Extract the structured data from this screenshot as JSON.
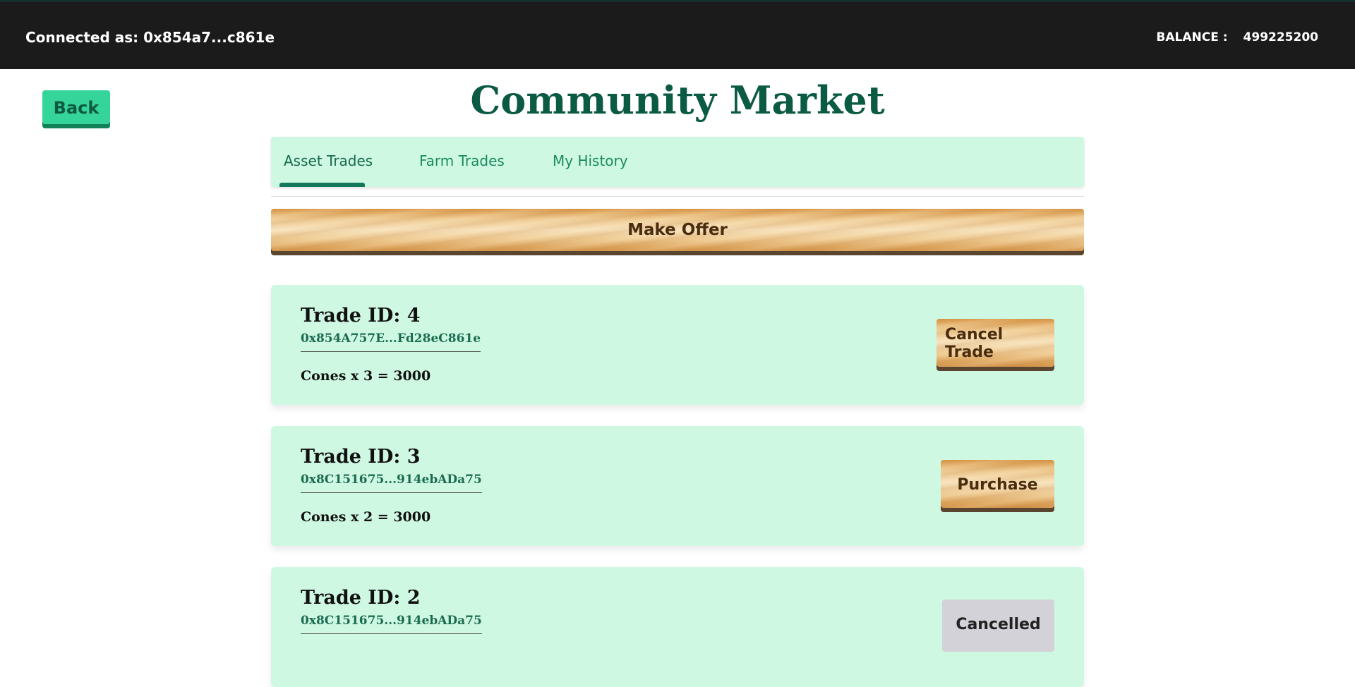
{
  "header": {
    "connected_text": "Connected as: 0x854a7...c861e",
    "balance_label": "BALANCE :",
    "balance_value": "499225200"
  },
  "back_label": "Back",
  "page_title": "Community Market",
  "tabs": [
    {
      "label": "Asset Trades",
      "active": true
    },
    {
      "label": "Farm Trades",
      "active": false
    },
    {
      "label": "My History",
      "active": false
    }
  ],
  "make_offer_label": "Make Offer",
  "trades": [
    {
      "id_text": "Trade ID: 4",
      "address": "0x854A757E...Fd28eC861e",
      "detail": "Cones x 3 = 3000",
      "action": "Cancel Trade"
    },
    {
      "id_text": "Trade ID: 3",
      "address": "0x8C151675...914ebADa75",
      "detail": "Cones x 2 = 3000",
      "action": "Purchase"
    },
    {
      "id_text": "Trade ID: 2",
      "address": "0x8C151675...914ebADa75",
      "detail": "",
      "action": "Cancelled"
    }
  ],
  "colors": {
    "accent": "#35d49a",
    "title": "#0b5a44",
    "card_bg": "#cff8e3",
    "topbar_bg": "#1b1b1b"
  }
}
